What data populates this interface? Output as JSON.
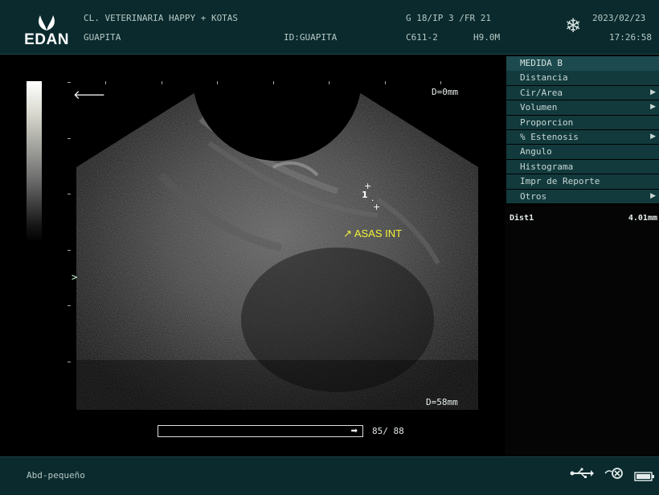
{
  "header": {
    "brand": "EDAN",
    "clinic": "CL. VETERINARIA HAPPY + KOTAS",
    "patient_name": "GUAPITA",
    "patient_id": "ID:GUAPITA",
    "image_params": "G 18/IP 3 /FR 21",
    "probe": "C611-2",
    "frequency": "H9.0M",
    "date": "2023/02/23",
    "time": "17:26:58",
    "freeze_icon": "snowflake-icon"
  },
  "image": {
    "depth_top": "D=0mm",
    "depth_bottom": "D=58mm",
    "annotation": "ASAS INT",
    "annotation_arrow": "↗",
    "caliper_marker": "1",
    "focus_marker": ">",
    "orientation_icon": "left-arrow-icon"
  },
  "cine": {
    "counter": "85/ 88",
    "progress": 0.966
  },
  "measure_menu": {
    "title": "MEDIDA B",
    "items": [
      {
        "label": "Distancia",
        "submenu": false
      },
      {
        "label": "Cir/Area",
        "submenu": true
      },
      {
        "label": "Volumen",
        "submenu": true
      },
      {
        "label": "Proporcion",
        "submenu": false
      },
      {
        "label": "% Estenosis",
        "submenu": true
      },
      {
        "label": "Angulo",
        "submenu": false
      },
      {
        "label": "Histograma",
        "submenu": false
      },
      {
        "label": "Impr de Reporte",
        "submenu": false
      },
      {
        "label": "Otros",
        "submenu": true
      }
    ]
  },
  "results": {
    "label": "Dist1",
    "value": "4.01mm"
  },
  "footer": {
    "preset": "Abd-pequeño",
    "icons": [
      "usb-icon",
      "network-icon",
      "battery-icon"
    ]
  }
}
